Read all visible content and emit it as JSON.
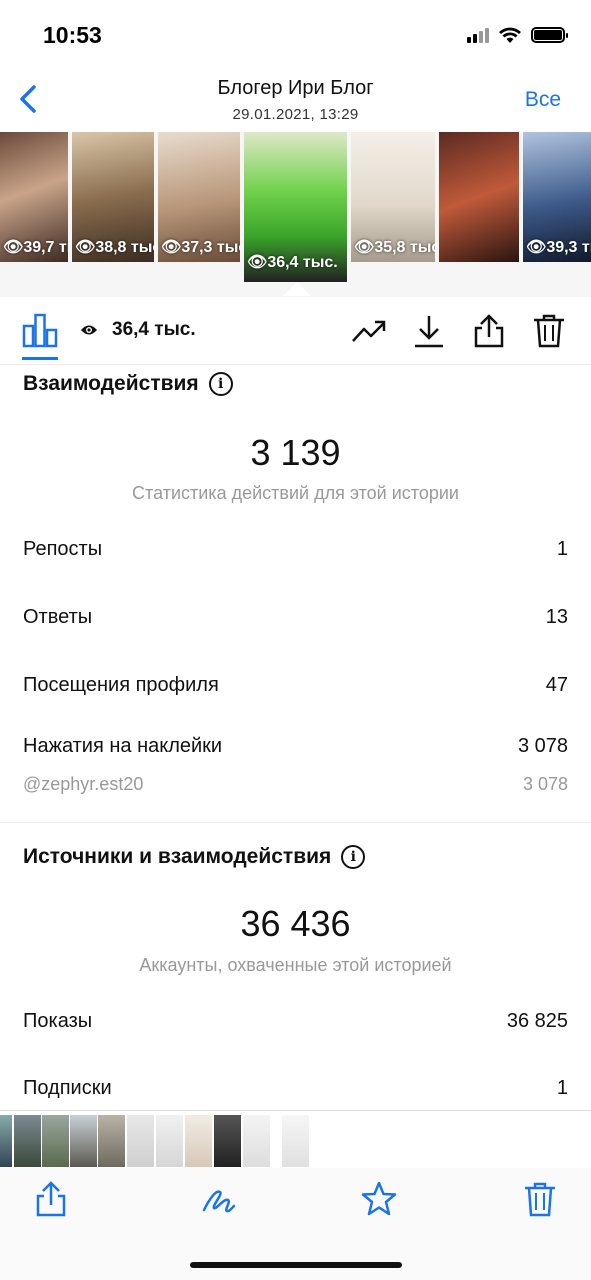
{
  "status": {
    "time": "10:53"
  },
  "nav": {
    "title": "Блогер  Ири Блог",
    "subtitle": "29.01.2021, 13:29",
    "right_label": "Все"
  },
  "stories": [
    {
      "views": "39,7 тыс."
    },
    {
      "views": "38,8 тыс."
    },
    {
      "views": "37,3 тыс."
    },
    {
      "views": "36,4 тыс.",
      "active": true
    },
    {
      "views": "35,8 тыс."
    },
    {
      "views": ""
    },
    {
      "views": "39,3 тыс."
    }
  ],
  "toolbar": {
    "views": "36,4 тыс.",
    "icons": [
      "bar-chart-icon",
      "eye-icon",
      "trend-icon",
      "download-icon",
      "share-icon",
      "trash-icon"
    ]
  },
  "interactions": {
    "title": "Взаимодействия",
    "total": "3 139",
    "caption": "Статистика действий для этой истории",
    "rows": [
      {
        "label": "Репосты",
        "value": "1"
      },
      {
        "label": "Ответы",
        "value": "13"
      },
      {
        "label": "Посещения профиля",
        "value": "47"
      },
      {
        "label": "Нажатия на наклейки",
        "value": "3 078"
      }
    ],
    "sub_row": {
      "label": "@zephyr.est20",
      "value": "3 078"
    }
  },
  "sources": {
    "title": "Источники и взаимодействия",
    "total": "36 436",
    "caption": "Аккаунты, охваченные этой историей",
    "rows": [
      {
        "label": "Показы",
        "value": "36 825"
      },
      {
        "label": "Подписки",
        "value": "1"
      }
    ]
  },
  "colors": {
    "accent": "#1a73e8"
  }
}
